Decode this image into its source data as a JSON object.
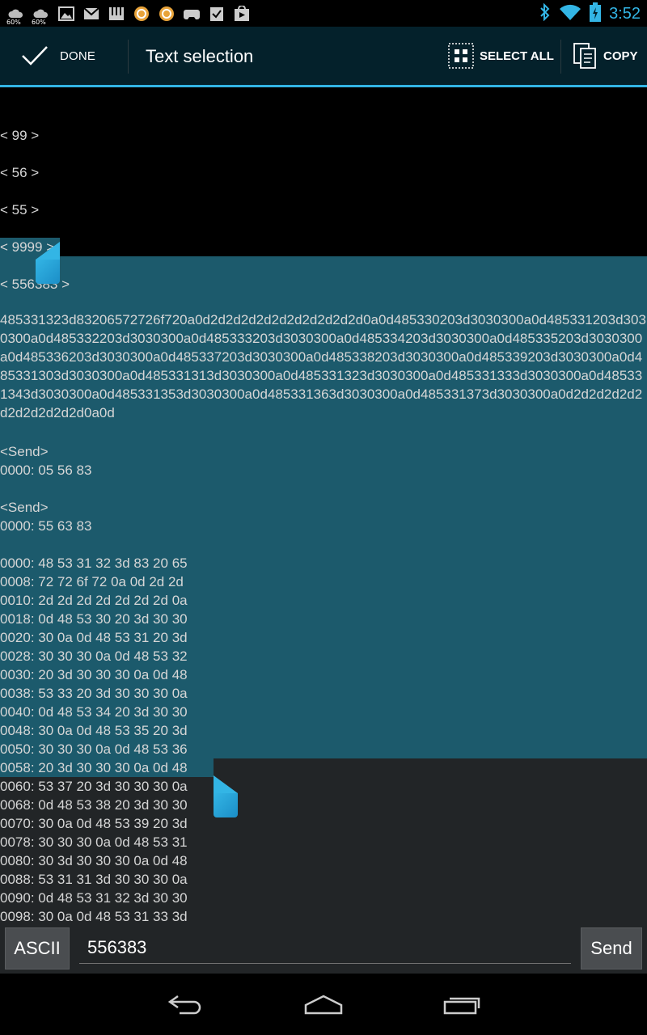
{
  "status_bar": {
    "left_icons": [
      {
        "name": "weather-icon",
        "label": "60%"
      },
      {
        "name": "weather-icon",
        "label": "60%"
      },
      {
        "name": "image-icon"
      },
      {
        "name": "gmail-icon"
      },
      {
        "name": "piano-icon"
      },
      {
        "name": "circle-app-icon"
      },
      {
        "name": "circle-app-icon"
      },
      {
        "name": "game-controller-icon"
      },
      {
        "name": "checklist-icon"
      },
      {
        "name": "play-store-icon"
      }
    ],
    "right_icons": [
      "bluetooth-icon",
      "wifi-icon",
      "battery-charging-icon"
    ],
    "time": "3:52"
  },
  "action_bar": {
    "done_label": "DONE",
    "title": "Text selection",
    "select_all_label": "SELECT ALL",
    "copy_label": "COPY",
    "accent_color": "#33b5e5",
    "background_color": "#04212b"
  },
  "content": {
    "lines_top": [
      "< 99 >",
      "< 56 >",
      "< 55 >",
      "< 9999 >",
      "< 556383 >"
    ],
    "hex_block": "485331323d83206572726f720a0d2d2d2d2d2d2d2d2d2d2d0a0d485330203d3030300a0d485331203d3030300a0d485332203d3030300a0d485333203d3030300a0d485334203d3030300a0d485335203d3030300a0d485336203d3030300a0d485337203d3030300a0d485338203d3030300a0d485339203d3030300a0d485331303d3030300a0d485331313d3030300a0d485331323d3030300a0d485331333d3030300a0d485331343d3030300a0d485331353d3030300a0d485331363d3030300a0d485331373d3030300a0d2d2d2d2d2d2d2d2d2d2d0a0d",
    "send_blocks": [
      {
        "tag": "<Send>",
        "line": "0000: 05 56 83"
      },
      {
        "tag": "<Send>",
        "line": "0000: 55 63 83"
      }
    ],
    "dump_lines": [
      "0000: 48 53 31 32 3d 83 20 65",
      "0008: 72 72 6f 72 0a 0d 2d 2d",
      "0010: 2d 2d 2d 2d 2d 2d 2d 0a",
      "0018: 0d 48 53 30 20 3d 30 30",
      "0020: 30 0a 0d 48 53 31 20 3d",
      "0028: 30 30 30 0a 0d 48 53 32",
      "0030: 20 3d 30 30 30 0a 0d 48",
      "0038: 53 33 20 3d 30 30 30 0a",
      "0040: 0d 48 53 34 20 3d 30 30",
      "0048: 30 0a 0d 48 53 35 20 3d",
      "0050: 30 30 30 0a 0d 48 53 36",
      "0058: 20 3d 30 30 30 0a 0d 48",
      "0060: 53 37 20 3d 30 30 30 0a",
      "0068: 0d 48 53 38 20 3d 30 30",
      "0070: 30 0a 0d 48 53 39 20 3d",
      "0078: 30 30 30 0a 0d 48 53 31",
      "0080: 30 3d 30 30 30 0a 0d 48",
      "0088: 53 31 31 3d 30 30 30 0a",
      "0090: 0d 48 53 31 32 3d 30 30",
      "0098: 30 0a 0d 48 53 31 33 3d"
    ],
    "selection_color": "#1c5a6c"
  },
  "input_bar": {
    "mode_label": "ASCII",
    "input_value": "556383",
    "send_label": "Send"
  },
  "nav_bar": {
    "buttons": [
      "back-icon",
      "home-icon",
      "recent-apps-icon"
    ]
  }
}
